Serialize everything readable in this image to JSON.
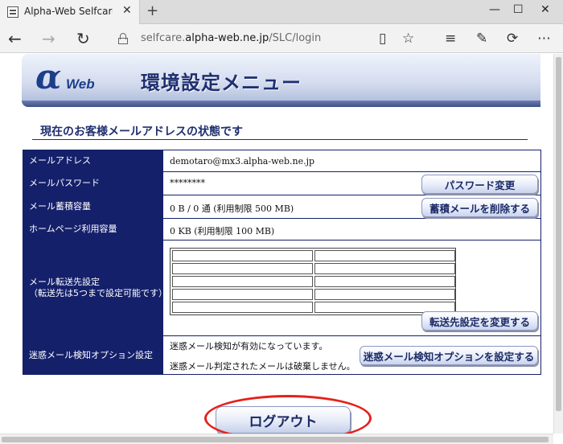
{
  "browser": {
    "tab_title": "Alpha-Web Selfcare Serv",
    "url_prefix": "selfcare.",
    "url_host": "alpha-web.ne.jp",
    "url_path": "/SLC/login"
  },
  "banner": {
    "logo_alpha": "α",
    "logo_web": "Web",
    "title": "環境設定メニュー"
  },
  "section_title": "現在のお客様メールアドレスの状態です",
  "rows": {
    "email": {
      "label": "メールアドレス",
      "value": "demotaro@mx3.alpha-web.ne.jp"
    },
    "password": {
      "label": "メールパスワード",
      "value": "********",
      "button": "パスワード変更"
    },
    "mail_storage": {
      "label": "メール蓄積容量",
      "value": "0 B / 0 通 (利用制限 500 MB)",
      "button": "蓄積メールを削除する"
    },
    "homepage_usage": {
      "label": "ホームページ利用容量",
      "value": "0 KB (利用制限 100 MB)"
    },
    "forwarding": {
      "label_line1": "メール転送先設定",
      "label_line2": "（転送先は5つまで設定可能です）",
      "button": "転送先設定を変更する"
    },
    "spam": {
      "label": "迷惑メール検知オプション設定",
      "note1": "迷惑メール検知が有効になっています。",
      "note2": "迷惑メール判定されたメールは破棄しません。",
      "button": "迷惑メール検知オプションを設定する"
    }
  },
  "logout_button": "ログアウト",
  "colors": {
    "label_bg": "#15206b",
    "highlight": "#e5211d"
  }
}
